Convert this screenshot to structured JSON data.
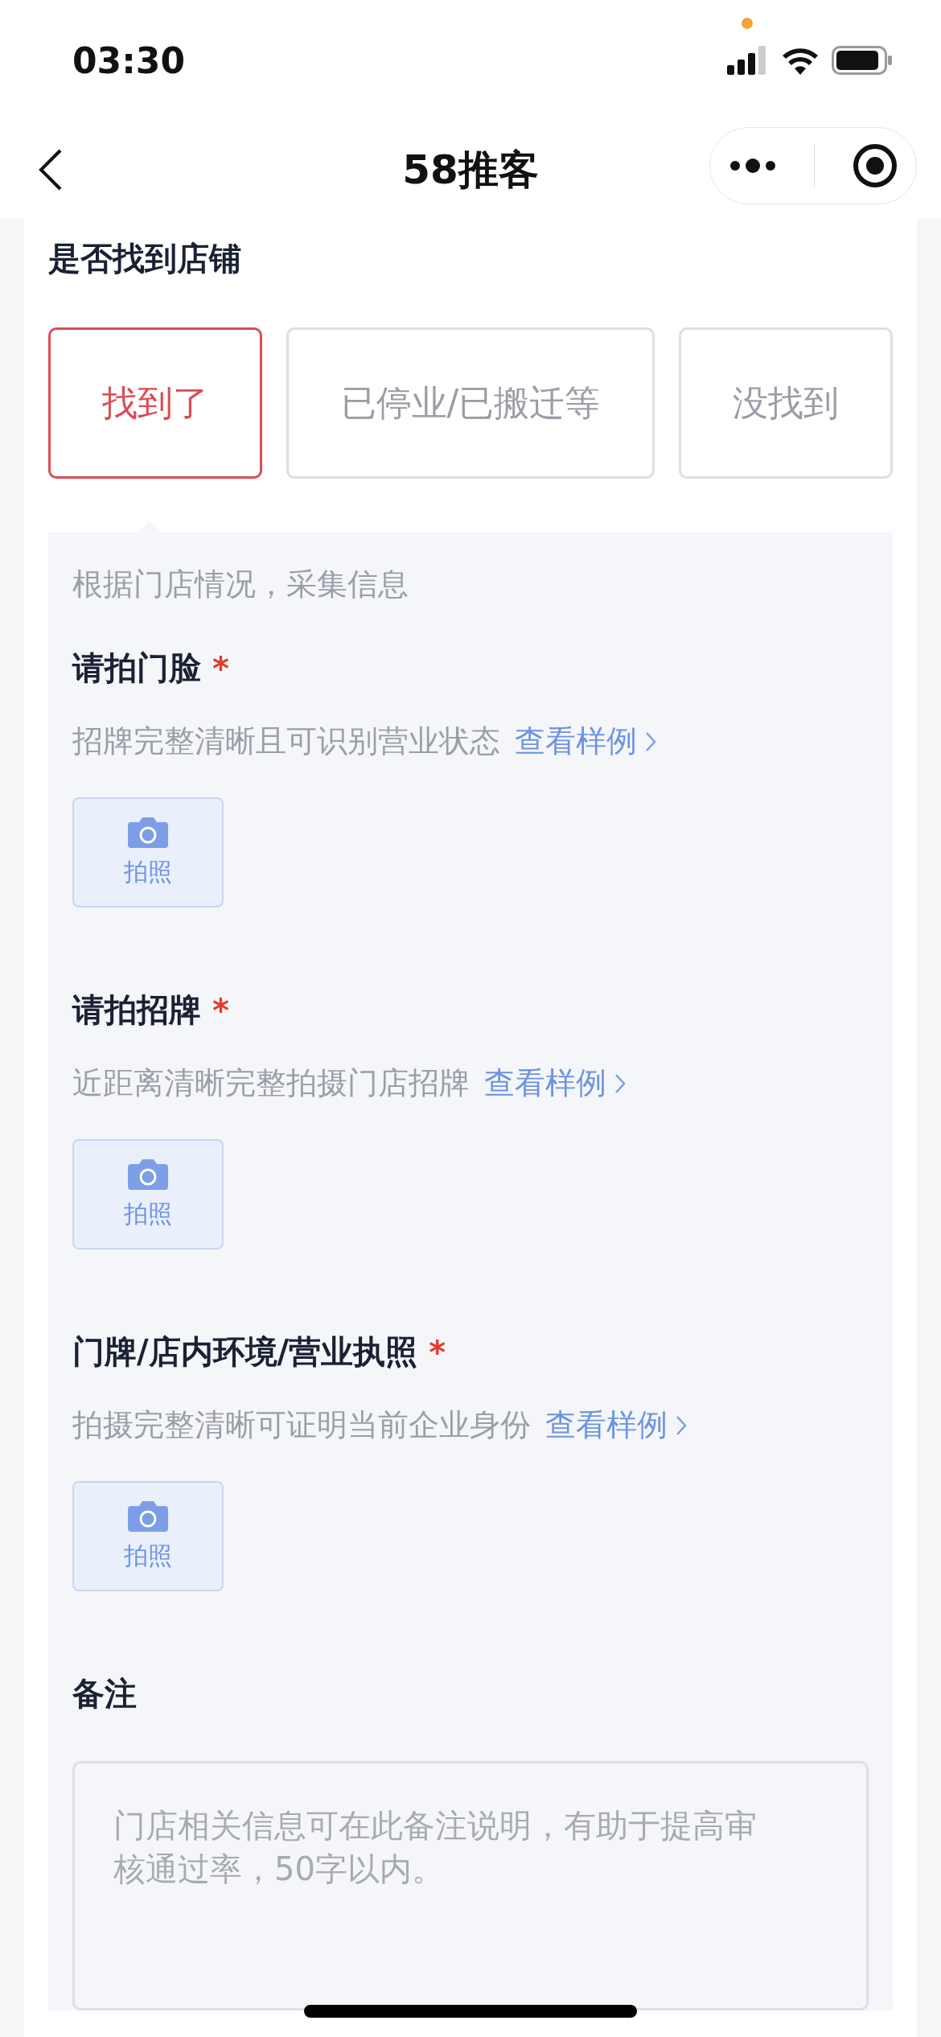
{
  "status_bar": {
    "time": "03:30"
  },
  "nav": {
    "title": "58推客"
  },
  "question": {
    "label": "是否找到店铺",
    "options": [
      {
        "label": "找到了",
        "selected": true
      },
      {
        "label": "已停业/已搬迁等",
        "selected": false
      },
      {
        "label": "没找到",
        "selected": false
      }
    ]
  },
  "panel": {
    "intro": "根据门店情况，采集信息",
    "sections": [
      {
        "title": "请拍门脸",
        "mark": "*",
        "hint": "招牌完整清晰且可识别营业状态",
        "link": "查看样例",
        "button": "拍照"
      },
      {
        "title": "请拍招牌",
        "mark": "*",
        "hint": "近距离清晰完整拍摄门店招牌",
        "link": "查看样例",
        "button": "拍照"
      },
      {
        "title": "门牌/店内环境/营业执照",
        "mark": "*",
        "hint": "拍摄完整清晰可证明当前企业身份",
        "link": "查看样例",
        "button": "拍照"
      }
    ],
    "remark": {
      "label": "备注",
      "placeholder": "门店相关信息可在此备注说明，有助于提高审核通过率，50字以内。"
    }
  }
}
